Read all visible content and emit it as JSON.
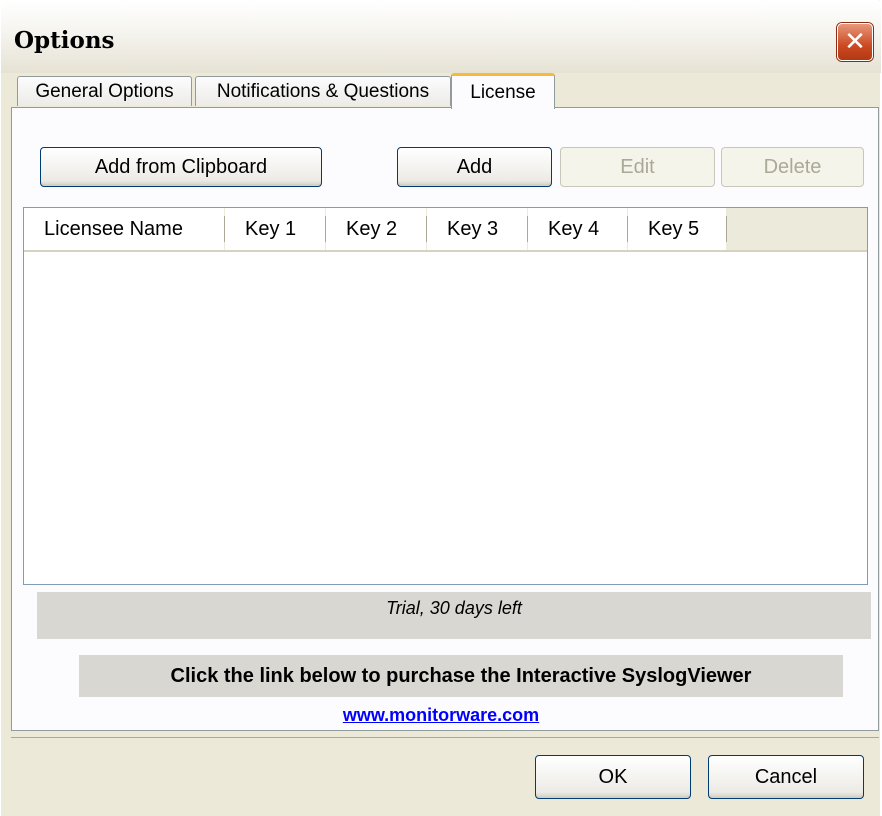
{
  "window": {
    "title": "Options",
    "close_glyph": "✕"
  },
  "tabs": [
    {
      "label": "General Options",
      "active": false
    },
    {
      "label": "Notifications & Questions",
      "active": false
    },
    {
      "label": "License",
      "active": true
    }
  ],
  "toolbar": {
    "add_from_clipboard": "Add from Clipboard",
    "add": "Add",
    "edit": "Edit",
    "delete": "Delete"
  },
  "license_table": {
    "columns": [
      "Licensee Name",
      "Key 1",
      "Key 2",
      "Key 3",
      "Key 4",
      "Key 5"
    ],
    "rows": []
  },
  "status": {
    "trial_text": "Trial, 30 days left"
  },
  "purchase": {
    "message": "Click the link below to purchase the Interactive SyslogViewer",
    "link_text": "www.monitorware.com"
  },
  "dialog_buttons": {
    "ok": "OK",
    "cancel": "Cancel"
  },
  "colors": {
    "window_bg": "#ece9d8",
    "active_tab_accent": "#f8b838",
    "link": "#0000ff",
    "close_button": "#cc4a22"
  }
}
